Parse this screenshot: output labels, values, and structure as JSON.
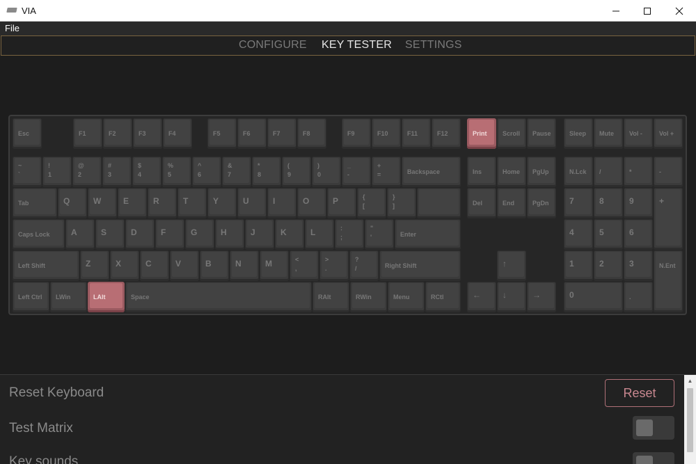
{
  "window": {
    "title": "VIA",
    "icon": "keyboard-icon"
  },
  "menu": {
    "file": "File"
  },
  "tabs": [
    {
      "label": "CONFIGURE",
      "active": false
    },
    {
      "label": "KEY TESTER",
      "active": true
    },
    {
      "label": "SETTINGS",
      "active": false
    }
  ],
  "keyboard": {
    "pressed_color": "#b86e74",
    "pressed_keys": [
      "Print",
      "LAlt"
    ]
  },
  "settings": {
    "reset_keyboard": {
      "label": "Reset Keyboard",
      "button": "Reset"
    },
    "test_matrix": {
      "label": "Test Matrix",
      "enabled": false
    },
    "key_sounds": {
      "label": "Key sounds",
      "enabled": false
    }
  },
  "colors": {
    "accent_border": "#7a6440",
    "reset_accent": "#c98890"
  }
}
